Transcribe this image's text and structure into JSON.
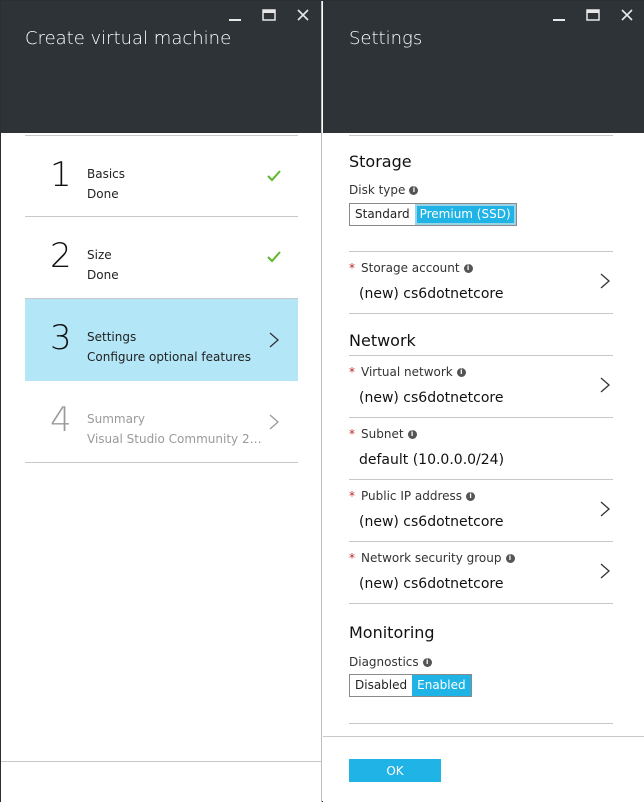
{
  "left_blade": {
    "title": "Create virtual machine",
    "steps": [
      {
        "number": "1",
        "name": "Basics",
        "status": "Done"
      },
      {
        "number": "2",
        "name": "Size",
        "status": "Done"
      },
      {
        "number": "3",
        "name": "Settings",
        "status": "Configure optional features"
      },
      {
        "number": "4",
        "name": "Summary",
        "status": "Visual Studio Community 2015 ..."
      }
    ]
  },
  "right_blade": {
    "title": "Settings",
    "storage": {
      "section_title": "Storage",
      "disk_type_label": "Disk type",
      "disk_type_options": [
        "Standard",
        "Premium (SSD)"
      ],
      "storage_account_label": "Storage account",
      "storage_account_value": "(new) cs6dotnetcore"
    },
    "network": {
      "section_title": "Network",
      "virtual_network_label": "Virtual network",
      "virtual_network_value": "(new) cs6dotnetcore",
      "subnet_label": "Subnet",
      "subnet_value": "default (10.0.0.0/24)",
      "public_ip_label": "Public IP address",
      "public_ip_value": "(new) cs6dotnetcore",
      "nsg_label": "Network security group",
      "nsg_value": "(new) cs6dotnetcore"
    },
    "monitoring": {
      "section_title": "Monitoring",
      "diagnostics_label": "Diagnostics",
      "diagnostics_options": [
        "Disabled",
        "Enabled"
      ]
    },
    "ok_label": "OK"
  },
  "colors": {
    "header_bg": "#2e3338",
    "accent": "#1fb3e6",
    "active_step_bg": "#b3e6f7",
    "check_green": "#5cb82d",
    "required_red": "#c0262d"
  },
  "icons": {
    "minimize": "minimize-icon",
    "maximize": "maximize-icon",
    "close": "close-icon",
    "check": "checkmark-icon",
    "chevron": "chevron-right-icon",
    "info": "info-icon"
  }
}
